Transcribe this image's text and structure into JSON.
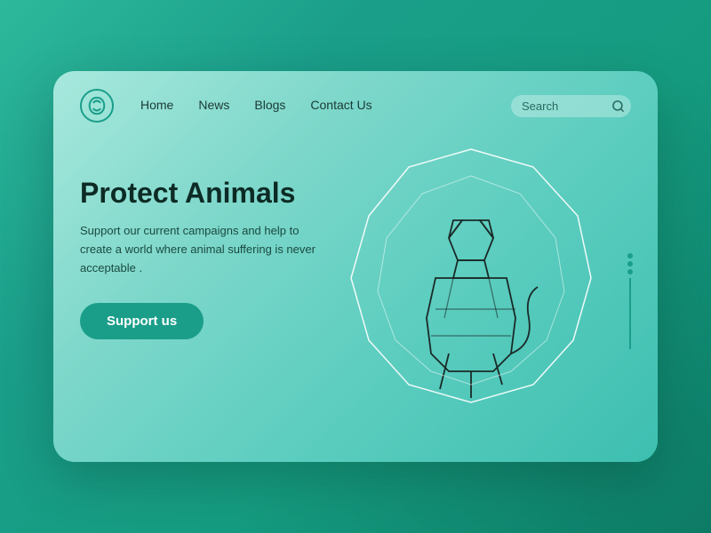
{
  "navbar": {
    "logo_alt": "Animal Protection Logo",
    "links": [
      {
        "label": "Home",
        "id": "home"
      },
      {
        "label": "News",
        "id": "news"
      },
      {
        "label": "Blogs",
        "id": "blogs"
      },
      {
        "label": "Contact Us",
        "id": "contact"
      }
    ],
    "search_placeholder": "Search"
  },
  "hero": {
    "title": "Protect Animals",
    "description": "Support our current campaigns and help to create a world where animal suffering is never acceptable .",
    "cta_label": "Support us"
  },
  "colors": {
    "primary": "#1a9e8a",
    "text_dark": "#0d2b25",
    "text_medium": "#1a4a40"
  }
}
